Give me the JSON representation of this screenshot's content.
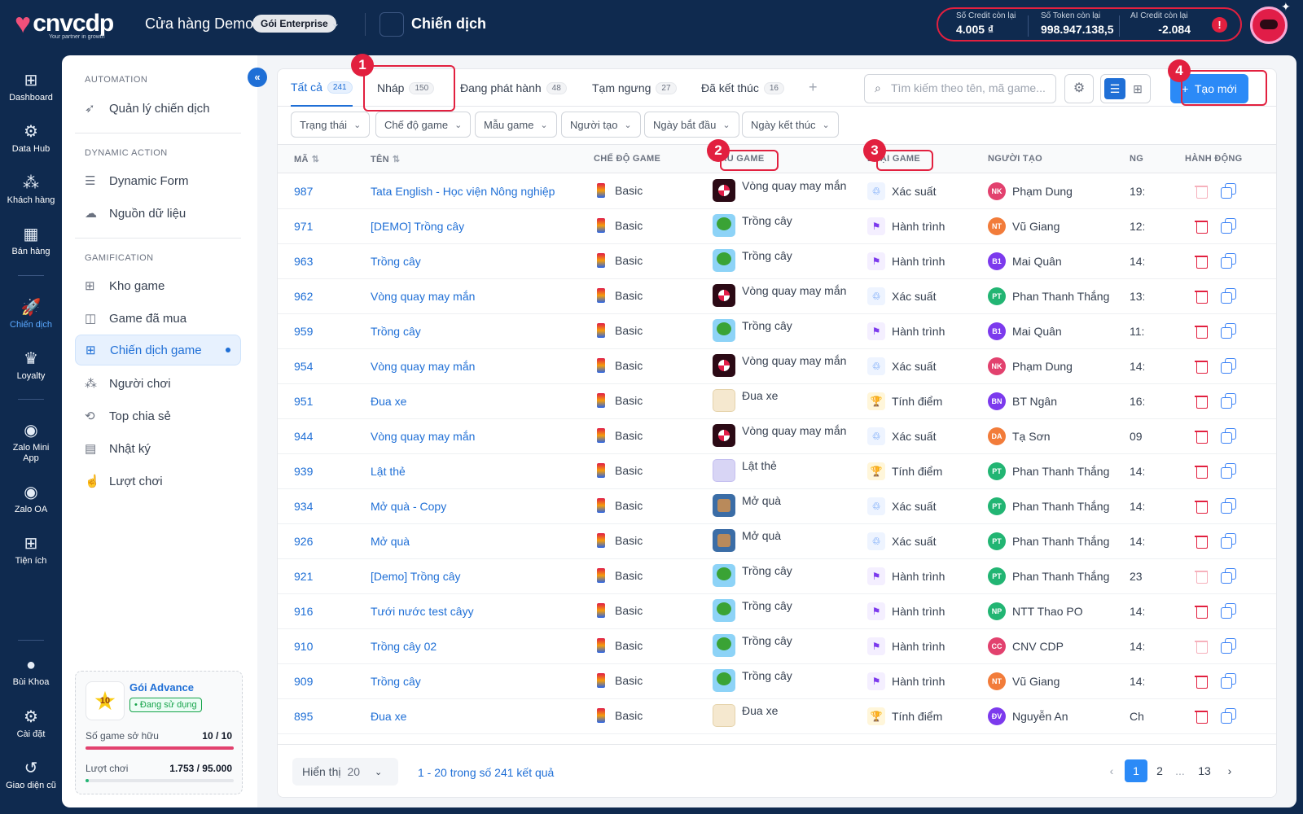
{
  "header": {
    "brand": "cnvcdp",
    "tagline": "Your partner in growth",
    "store_name": "Cửa hàng Demo",
    "plan_badge": "Gói Enterprise",
    "page_title": "Chiến dịch",
    "credits": [
      {
        "label": "Số Credit còn lại",
        "value": "4.005 ₫"
      },
      {
        "label": "Số Token còn lại",
        "value": "998.947.138,5"
      },
      {
        "label": "AI Credit còn lại",
        "value": "-2.084"
      }
    ],
    "info_icon": "!"
  },
  "nav": [
    {
      "label": "Dashboard",
      "icon": "dashboard-icon",
      "glyph": "⊞"
    },
    {
      "label": "Data Hub",
      "icon": "data-hub-icon",
      "glyph": "⚙"
    },
    {
      "label": "Khách hàng",
      "icon": "customers-icon",
      "glyph": "⁂"
    },
    {
      "label": "Bán hàng",
      "icon": "store-icon",
      "glyph": "▦"
    },
    {
      "label": "Chiến dịch",
      "icon": "rocket-icon",
      "glyph": "🚀",
      "active": true
    },
    {
      "label": "Loyalty",
      "icon": "loyalty-icon",
      "glyph": "♛"
    },
    {
      "label": "Zalo Mini App",
      "icon": "zalo-mini-app-icon",
      "glyph": "◉"
    },
    {
      "label": "Zalo OA",
      "icon": "zalo-oa-icon",
      "glyph": "◉"
    },
    {
      "label": "Tiện ích",
      "icon": "utilities-icon",
      "glyph": "⊞"
    },
    {
      "label": "Bùi Khoa",
      "icon": "user-avatar-icon",
      "glyph": "●"
    },
    {
      "label": "Cài đặt",
      "icon": "settings-icon",
      "glyph": "⚙"
    },
    {
      "label": "Giao diện cũ",
      "icon": "old-ui-icon",
      "glyph": "↺"
    }
  ],
  "sidebar": {
    "section1": "AUTOMATION",
    "item1": "Quản lý chiến dịch",
    "section2": "DYNAMIC ACTION",
    "item2": "Dynamic Form",
    "item3": "Nguồn dữ liệu",
    "section3": "GAMIFICATION",
    "item4": "Kho game",
    "item5": "Game đã mua",
    "item6": "Chiến dịch game",
    "item7": "Người chơi",
    "item8": "Top chia sẻ",
    "item9": "Nhật ký",
    "item10": "Lượt chơi",
    "package": {
      "badge_number": "10",
      "name": "Gói Advance",
      "status": "• Đang sử dụng",
      "games_label": "Số game sở hữu",
      "games_value": "10 / 10",
      "games_fraction": 1.0,
      "plays_label": "Lượt chơi",
      "plays_value": "1.753 / 95.000",
      "plays_fraction": 0.018
    }
  },
  "tabs": [
    {
      "label": "Tất cả",
      "count": "241",
      "active": true
    },
    {
      "label": "Nháp",
      "count": "150"
    },
    {
      "label": "Đang phát hành",
      "count": "48"
    },
    {
      "label": "Tạm ngưng",
      "count": "27"
    },
    {
      "label": "Đã kết thúc",
      "count": "16"
    }
  ],
  "search_placeholder": "Tìm kiếm theo tên, mã game...",
  "create_label": "Tạo mới",
  "filters": [
    "Trạng thái",
    "Chế độ game",
    "Mẫu game",
    "Người tạo",
    "Ngày bắt đầu",
    "Ngày kết thúc"
  ],
  "columns": {
    "code": "MÃ",
    "name": "TÊN",
    "mode": "CHẾ ĐỘ GAME",
    "template": "MẪU GAME",
    "type": "LOẠI GAME",
    "creator": "NGƯỜI TẠO",
    "date": "NG",
    "actions": "HÀNH ĐỘNG"
  },
  "rows": [
    {
      "code": "987",
      "name": "Tata English - Học viện Nông nghiệp",
      "mode": "Basic",
      "template": "Vòng quay may mắn",
      "type": "Xác suất",
      "initials": "NK",
      "avatar_color": "#e2416e",
      "creator": "Phạm Dung",
      "date": "19:",
      "delete_enabled": false
    },
    {
      "code": "971",
      "name": "[DEMO] Trồng cây",
      "mode": "Basic",
      "template": "Trồng cây",
      "type": "Hành trình",
      "initials": "NT",
      "avatar_color": "#f27c3a",
      "creator": "Vũ Giang",
      "date": "12:",
      "delete_enabled": true
    },
    {
      "code": "963",
      "name": "Trồng cây",
      "mode": "Basic",
      "template": "Trồng cây",
      "type": "Hành trình",
      "initials": "B1",
      "avatar_color": "#7c3aed",
      "creator": "Mai Quân",
      "date": "14:",
      "delete_enabled": true
    },
    {
      "code": "962",
      "name": "Vòng quay may mắn",
      "mode": "Basic",
      "template": "Vòng quay may mắn",
      "type": "Xác suất",
      "initials": "PT",
      "avatar_color": "#22b573",
      "creator": "Phan Thanh Thắng",
      "date": "13:",
      "delete_enabled": true
    },
    {
      "code": "959",
      "name": "Trồng cây",
      "mode": "Basic",
      "template": "Trồng cây",
      "type": "Hành trình",
      "initials": "B1",
      "avatar_color": "#7c3aed",
      "creator": "Mai Quân",
      "date": "11:",
      "delete_enabled": true
    },
    {
      "code": "954",
      "name": "Vòng quay may mắn",
      "mode": "Basic",
      "template": "Vòng quay may mắn",
      "type": "Xác suất",
      "initials": "NK",
      "avatar_color": "#e2416e",
      "creator": "Phạm Dung",
      "date": "14:",
      "delete_enabled": true
    },
    {
      "code": "951",
      "name": "Đua xe",
      "mode": "Basic",
      "template": "Đua xe",
      "type": "Tính điểm",
      "initials": "BN",
      "avatar_color": "#7c3aed",
      "creator": "BT Ngân",
      "date": "16:",
      "delete_enabled": true
    },
    {
      "code": "944",
      "name": "Vòng quay may mắn",
      "mode": "Basic",
      "template": "Vòng quay may mắn",
      "type": "Xác suất",
      "initials": "DA",
      "avatar_color": "#f27c3a",
      "creator": "Tạ Sơn",
      "date": "09",
      "delete_enabled": true
    },
    {
      "code": "939",
      "name": "Lật thẻ",
      "mode": "Basic",
      "template": "Lật thẻ",
      "type": "Tính điểm",
      "initials": "PT",
      "avatar_color": "#22b573",
      "creator": "Phan Thanh Thắng",
      "date": "14:",
      "delete_enabled": true
    },
    {
      "code": "934",
      "name": "Mở quà - Copy",
      "mode": "Basic",
      "template": "Mở quà",
      "type": "Xác suất",
      "initials": "PT",
      "avatar_color": "#22b573",
      "creator": "Phan Thanh Thắng",
      "date": "14:",
      "delete_enabled": true
    },
    {
      "code": "926",
      "name": "Mở quà",
      "mode": "Basic",
      "template": "Mở quà",
      "type": "Xác suất",
      "initials": "PT",
      "avatar_color": "#22b573",
      "creator": "Phan Thanh Thắng",
      "date": "14:",
      "delete_enabled": true
    },
    {
      "code": "921",
      "name": "[Demo] Trồng cây",
      "mode": "Basic",
      "template": "Trồng cây",
      "type": "Hành trình",
      "initials": "PT",
      "avatar_color": "#22b573",
      "creator": "Phan Thanh Thắng",
      "date": "23",
      "delete_enabled": false
    },
    {
      "code": "916",
      "name": "Tưới nước test câyy",
      "mode": "Basic",
      "template": "Trồng cây",
      "type": "Hành trình",
      "initials": "NP",
      "avatar_color": "#22b573",
      "creator": "NTT Thao PO",
      "date": "14:",
      "delete_enabled": true
    },
    {
      "code": "910",
      "name": "Trồng cây 02",
      "mode": "Basic",
      "template": "Trồng cây",
      "type": "Hành trình",
      "initials": "CC",
      "avatar_color": "#e2416e",
      "creator": "CNV CDP",
      "date": "14:",
      "delete_enabled": false
    },
    {
      "code": "909",
      "name": "Trồng cây",
      "mode": "Basic",
      "template": "Trồng cây",
      "type": "Hành trình",
      "initials": "NT",
      "avatar_color": "#f27c3a",
      "creator": "Vũ Giang",
      "date": "14:",
      "delete_enabled": true
    },
    {
      "code": "895",
      "name": "Đua xe",
      "mode": "Basic",
      "template": "Đua xe",
      "type": "Tính điểm",
      "initials": "ĐV",
      "avatar_color": "#7c3aed",
      "creator": "Nguyễn An",
      "date": "Ch",
      "delete_enabled": true
    }
  ],
  "footer": {
    "page_size_label": "Hiển thị",
    "page_size": "20",
    "result_text": "1 - 20 trong số 241 kết quả",
    "pages": [
      "1",
      "2",
      "...",
      "13"
    ],
    "current_page": "1"
  },
  "markers": [
    "1",
    "2",
    "3",
    "4"
  ],
  "colors": {
    "accent": "#1f6fd6",
    "primary_button": "#2b8af7",
    "annotation_red": "#e2203f",
    "nav_bg": "#0f2a4f"
  }
}
